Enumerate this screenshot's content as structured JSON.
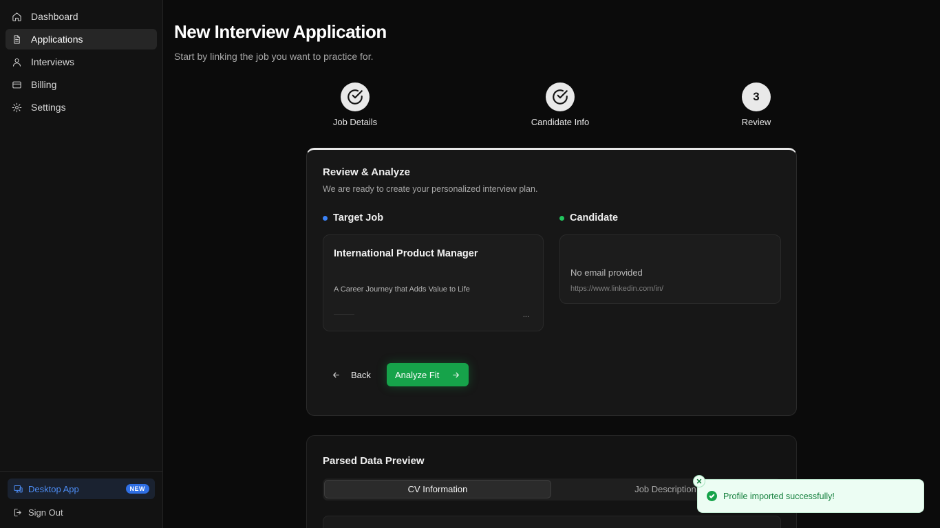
{
  "sidebar": {
    "items": [
      {
        "label": "Dashboard",
        "icon": "home-icon"
      },
      {
        "label": "Applications",
        "icon": "document-icon"
      },
      {
        "label": "Interviews",
        "icon": "user-icon"
      },
      {
        "label": "Billing",
        "icon": "credit-card-icon"
      },
      {
        "label": "Settings",
        "icon": "gear-icon"
      }
    ],
    "active_item": "Applications",
    "desktop_app": {
      "label": "Desktop App",
      "badge": "NEW"
    },
    "sign_out": "Sign Out"
  },
  "header": {
    "title": "New Interview Application",
    "subtitle": "Start by linking the job you want to practice for."
  },
  "stepper": {
    "steps": [
      {
        "label": "Job Details",
        "state": "complete"
      },
      {
        "label": "Candidate Info",
        "state": "complete"
      },
      {
        "label": "Review",
        "number": "3",
        "state": "current"
      }
    ]
  },
  "review": {
    "title": "Review & Analyze",
    "description": "We are ready to create your personalized interview plan.",
    "target_job": {
      "heading": "Target Job",
      "job_title": "International Product Manager",
      "description_line": "A Career Journey that Adds Value to Life",
      "ellipsis": "..."
    },
    "candidate": {
      "heading": "Candidate",
      "email": "No email provided",
      "linkedin": "https://www.linkedin.com/in/"
    },
    "back_label": "Back",
    "analyze_label": "Analyze Fit"
  },
  "preview": {
    "title": "Parsed Data Preview",
    "tabs": [
      "CV Information",
      "Job Description"
    ],
    "active_tab": "CV Information"
  },
  "toast": {
    "message": "Profile imported successfully!"
  },
  "colors": {
    "accent_green": "#16a34a",
    "job_dot": "#3b82f6",
    "candidate_dot": "#22c55e",
    "desktop_app_blue": "#4d8df5"
  }
}
